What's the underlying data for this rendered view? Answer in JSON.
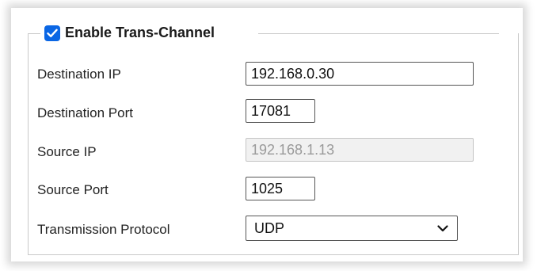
{
  "section": {
    "enabled": true,
    "title": "Enable Trans-Channel"
  },
  "fields": {
    "destination_ip": {
      "label": "Destination IP",
      "value": "192.168.0.30"
    },
    "destination_port": {
      "label": "Destination Port",
      "value": "17081"
    },
    "source_ip": {
      "label": "Source IP",
      "value": "192.168.1.13",
      "disabled": true
    },
    "source_port": {
      "label": "Source Port",
      "value": "1025"
    },
    "transmission_protocol": {
      "label": "Transmission Protocol",
      "value": "UDP"
    }
  },
  "colors": {
    "checkbox": "#0a66e4",
    "border": "#555555",
    "disabled_bg": "#f1f1f1",
    "disabled_text": "#9a9a9a"
  },
  "icons": {
    "checkbox": "check-icon",
    "dropdown": "chevron-down-icon"
  }
}
